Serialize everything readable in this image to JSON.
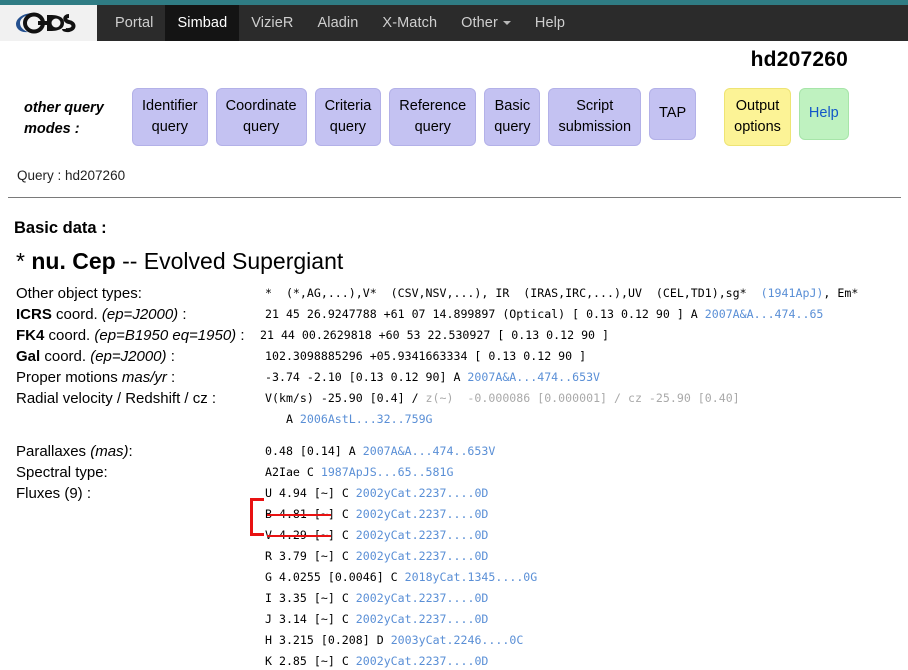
{
  "colors": {
    "teal_strip": "#2f7c84",
    "navbar_bg": "#2b2b2b",
    "nav_active_bg": "#141414",
    "button_lavender": "#c4c2f2",
    "button_yellow": "#fcf396",
    "button_green": "#bff2c0",
    "link_blue": "#5a8fd6",
    "annotation_red": "#e81212"
  },
  "nav": {
    "logo": "cds-logo",
    "items": [
      {
        "label": "Portal",
        "active": false,
        "has_caret": false
      },
      {
        "label": "Simbad",
        "active": true,
        "has_caret": false
      },
      {
        "label": "VizieR",
        "active": false,
        "has_caret": false
      },
      {
        "label": "Aladin",
        "active": false,
        "has_caret": false
      },
      {
        "label": "X-Match",
        "active": false,
        "has_caret": false
      },
      {
        "label": "Other",
        "active": false,
        "has_caret": true
      },
      {
        "label": "Help",
        "active": false,
        "has_caret": false
      }
    ]
  },
  "page_title": "hd207260",
  "query_modes": {
    "label": "other query\nmodes :",
    "buttons": [
      {
        "label": "Identifier\nquery",
        "style": "lavender"
      },
      {
        "label": "Coordinate\nquery",
        "style": "lavender"
      },
      {
        "label": "Criteria\nquery",
        "style": "lavender"
      },
      {
        "label": "Reference\nquery",
        "style": "lavender"
      },
      {
        "label": "Basic\nquery",
        "style": "lavender"
      },
      {
        "label": "Script\nsubmission",
        "style": "lavender"
      },
      {
        "label": "TAP",
        "style": "lavender"
      },
      {
        "label": "Output\noptions",
        "style": "yellow"
      },
      {
        "label": "Help",
        "style": "green"
      }
    ]
  },
  "query_line": "Query : hd207260",
  "basic_data": {
    "heading": "Basic data :",
    "object_name": "* nu. Cep",
    "object_prefix": "* ",
    "object_ident": "nu. Cep",
    "object_desc": " -- Evolved Supergiant",
    "rows": {
      "other_types_label": "Other object types:",
      "other_types_value_a": "*  (*,AG,...),V*  (CSV,NSV,...), IR  (IRAS,IRC,...),UV  (CEL,TD1),sg*  ",
      "other_types_link": "(1941ApJ)",
      "other_types_value_b": ", Em*",
      "icrs_label_bold": "ICRS",
      "icrs_label_rest": " coord. ",
      "icrs_label_italic": "(ep=J2000)",
      "icrs_label_end": " :",
      "icrs_value": "21 45 26.9247788 +61 07 14.899897 (Optical) [ 0.13 0.12 90 ] A ",
      "icrs_link": "2007A&A...474..65",
      "fk4_label_bold": "FK4",
      "fk4_label_rest": " coord. ",
      "fk4_label_italic": "(ep=B1950 eq=1950)",
      "fk4_label_end": " :",
      "fk4_value": "21 44 00.2629818 +60 53 22.530927 [ 0.13 0.12 90 ]",
      "gal_label_bold": "Gal",
      "gal_label_rest": " coord. ",
      "gal_label_italic": "(ep=J2000)",
      "gal_label_end": " :",
      "gal_value": "102.3098885296 +05.9341663334 [ 0.13 0.12 90 ]",
      "pm_label": "Proper motions ",
      "pm_label_italic": "mas/yr",
      "pm_label_end": " :",
      "pm_value": "-3.74 -2.10 [0.13 0.12 90] A ",
      "pm_link": "2007A&A...474..653V",
      "rv_label": "Radial velocity / Redshift / cz :",
      "rv_value_a": "V(km/s) -25.90 [0.4] / ",
      "rv_value_dim": "z(~)  -0.000086 [0.000001]",
      "rv_value_b": " / ",
      "rv_value_dim2": "cz -25.90 [0.40]",
      "rv_line2_a": "   A ",
      "rv_line2_link": "2006AstL...32..759G",
      "parallax_label_plain": "Parallaxes ",
      "parallax_label_italic": "(mas)",
      "parallax_label_end": ":",
      "parallax_value": "0.48 [0.14] A ",
      "parallax_link": "2007A&A...474..653V",
      "spectral_label": "Spectral type:",
      "spectral_value": "A2Iae C ",
      "spectral_link": "1987ApJS...65..581G",
      "fluxes_label": "Fluxes (9) :"
    },
    "fluxes": [
      {
        "band": "U",
        "mag": "4.94",
        "err": "[~]",
        "qual": "C",
        "ref": "2002yCat.2237....0D",
        "highlight": false
      },
      {
        "band": "B",
        "mag": "4.81",
        "err": "[~]",
        "qual": "C",
        "ref": "2002yCat.2237....0D",
        "highlight": true
      },
      {
        "band": "V",
        "mag": "4.29",
        "err": "[~]",
        "qual": "C",
        "ref": "2002yCat.2237....0D",
        "highlight": true
      },
      {
        "band": "R",
        "mag": "3.79",
        "err": "[~]",
        "qual": "C",
        "ref": "2002yCat.2237....0D",
        "highlight": false
      },
      {
        "band": "G",
        "mag": "4.0255",
        "err": "[0.0046]",
        "qual": "C",
        "ref": "2018yCat.1345....0G",
        "highlight": false
      },
      {
        "band": "I",
        "mag": "3.35",
        "err": "[~]",
        "qual": "C",
        "ref": "2002yCat.2237....0D",
        "highlight": false
      },
      {
        "band": "J",
        "mag": "3.14",
        "err": "[~]",
        "qual": "C",
        "ref": "2002yCat.2237....0D",
        "highlight": false
      },
      {
        "band": "H",
        "mag": "3.215",
        "err": "[0.208]",
        "qual": "D",
        "ref": "2003yCat.2246....0C",
        "highlight": false
      },
      {
        "band": "K",
        "mag": "2.85",
        "err": "[~]",
        "qual": "C",
        "ref": "2002yCat.2237....0D",
        "highlight": false
      }
    ]
  }
}
